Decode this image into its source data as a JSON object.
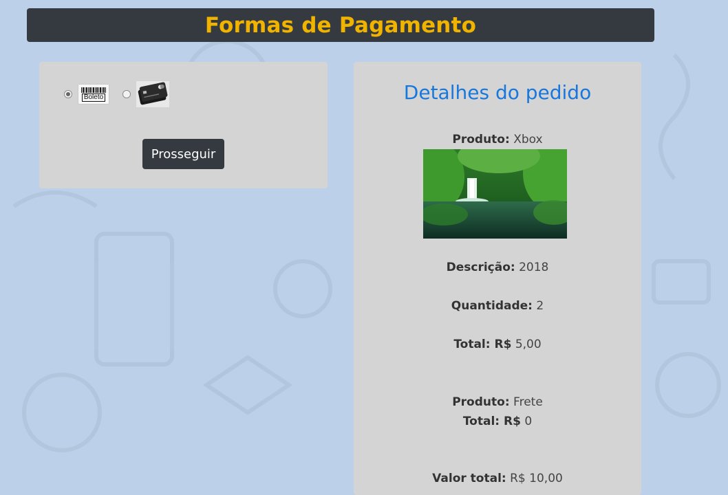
{
  "header": {
    "title": "Formas de Pagamento"
  },
  "payment": {
    "options": [
      {
        "label": "Boleto",
        "selected": true,
        "icon": "boleto-barcode-icon"
      },
      {
        "label": "",
        "selected": false,
        "icon": "credit-card-icon"
      }
    ],
    "proceed_label": "Prosseguir"
  },
  "details": {
    "title": "Detalhes do pedido",
    "product_label": "Produto:",
    "product_value": "Xbox",
    "description_label": "Descrição:",
    "description_value": "2018",
    "quantity_label": "Quantidade:",
    "quantity_value": "2",
    "total_label": "Total: R$",
    "total_value": "5,00",
    "shipping_product_label": "Produto:",
    "shipping_product_value": "Frete",
    "shipping_total_label": "Total: R$",
    "shipping_total_value": "0",
    "grand_total_label": "Valor total:",
    "grand_total_value": "R$ 10,00"
  },
  "colors": {
    "background": "#bcd0e9",
    "header_bg": "#343a40",
    "header_text": "#f0b400",
    "panel_bg": "#d4d4d4",
    "title_blue": "#1877dd"
  }
}
